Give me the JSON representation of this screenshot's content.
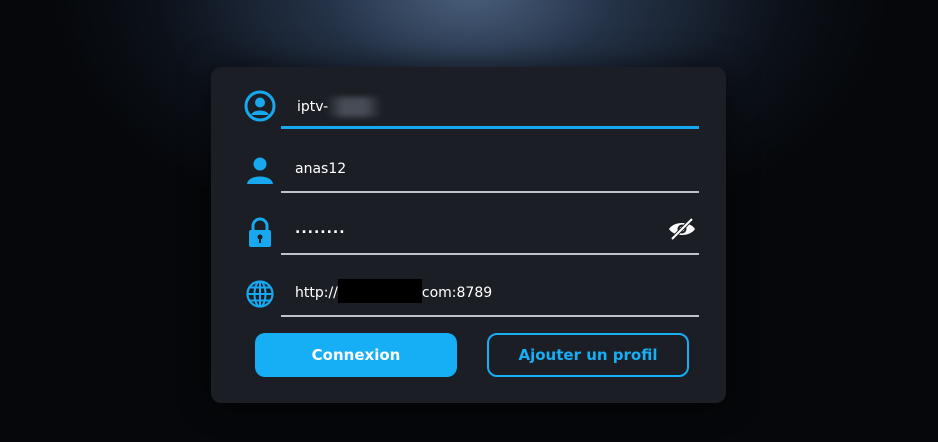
{
  "form": {
    "server_name": {
      "value": "iptv-",
      "icon": "user-circle-icon"
    },
    "username": {
      "value": "anas12",
      "icon": "user-icon"
    },
    "password": {
      "value": "........",
      "icon": "lock-icon",
      "toggle_icon": "eye-slash-icon"
    },
    "url": {
      "prefix": "http://",
      "suffix": "com:8789",
      "icon": "globe-icon"
    }
  },
  "buttons": {
    "connect_label": "Connexion",
    "add_profile_label": "Ajouter un profil"
  },
  "colors": {
    "accent": "#16aef5",
    "panel": "#1b1e24",
    "underline": "#bfc3c9"
  }
}
